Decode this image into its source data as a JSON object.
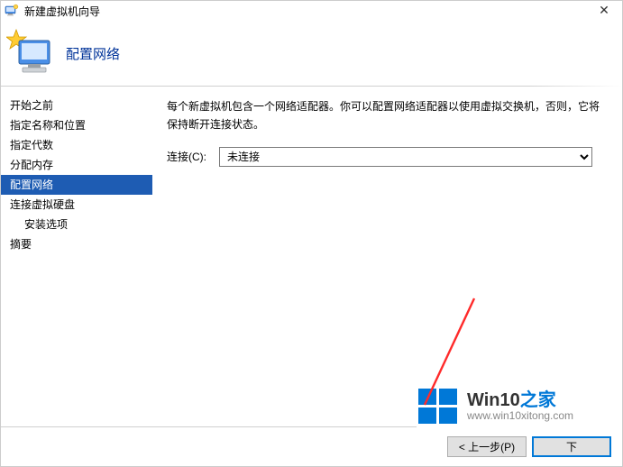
{
  "titlebar": {
    "title": "新建虚拟机向导"
  },
  "header": {
    "page_title": "配置网络"
  },
  "sidebar": {
    "items": [
      {
        "label": "开始之前",
        "selected": false,
        "sub": false
      },
      {
        "label": "指定名称和位置",
        "selected": false,
        "sub": false
      },
      {
        "label": "指定代数",
        "selected": false,
        "sub": false
      },
      {
        "label": "分配内存",
        "selected": false,
        "sub": false
      },
      {
        "label": "配置网络",
        "selected": true,
        "sub": false
      },
      {
        "label": "连接虚拟硬盘",
        "selected": false,
        "sub": false
      },
      {
        "label": "安装选项",
        "selected": false,
        "sub": true
      },
      {
        "label": "摘要",
        "selected": false,
        "sub": false
      }
    ]
  },
  "content": {
    "description": "每个新虚拟机包含一个网络适配器。你可以配置网络适配器以使用虚拟交换机，否则，它将保持断开连接状态。",
    "connect_label": "连接(C):",
    "connect_value": "未连接"
  },
  "footer": {
    "prev": "< 上一步(P)",
    "next": "下"
  },
  "watermark": {
    "brand_pre": "Win10",
    "brand_post": "之家",
    "url": "www.win10xitong.com"
  }
}
